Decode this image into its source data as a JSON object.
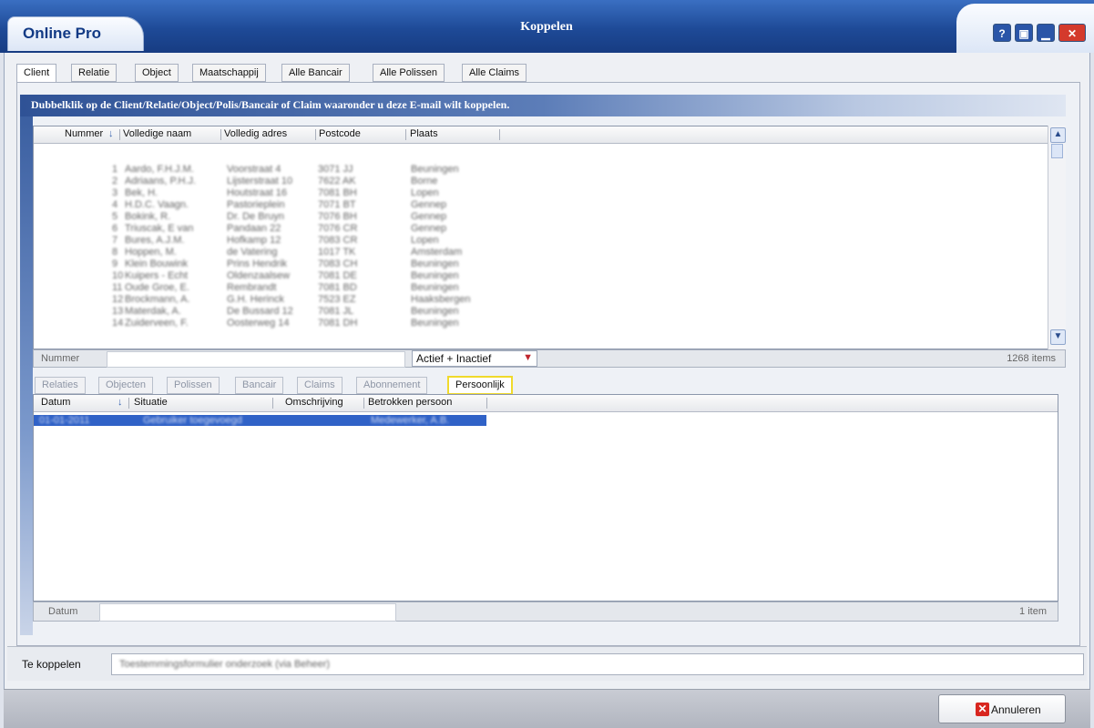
{
  "app": {
    "brand": "Online Pro",
    "title": "Koppelen"
  },
  "window_buttons": [
    "help-icon",
    "restore-icon",
    "minimize-icon",
    "close-icon"
  ],
  "tabs": [
    "Client",
    "Relatie",
    "Object",
    "Maatschappij",
    "Alle Bancair",
    "Alle Polissen",
    "Alle Claims"
  ],
  "active_tab": "Client",
  "banner": "Dubbelklik op de Client/Relatie/Object/Polis/Bancair of Claim waaronder u deze E-mail wilt koppelen.",
  "grid1": {
    "columns": [
      "Nummer",
      "Volledige naam",
      "Volledig adres",
      "Postcode",
      "Plaats"
    ],
    "sort_column": "Nummer",
    "rows_blurred": true
  },
  "filter": {
    "field_label": "Nummer",
    "status_value": "Actief + Inactief",
    "item_count": "1268 items"
  },
  "subtabs": [
    "Relaties",
    "Objecten",
    "Polissen",
    "Bancair",
    "Claims",
    "Abonnement",
    "Persoonlijk"
  ],
  "active_subtab": "Persoonlijk",
  "grid2": {
    "columns": [
      "Datum",
      "Situatie",
      "Omschrijving",
      "Betrokken persoon"
    ],
    "sort_column": "Situatie",
    "footer_label": "Datum",
    "item_count": "1 item"
  },
  "link": {
    "label": "Te koppelen"
  },
  "cancel_label": "Annuleren",
  "colors": {
    "titlebar": "#1e4a97",
    "selection": "#3062c7",
    "highlight": "#f0da2c"
  }
}
